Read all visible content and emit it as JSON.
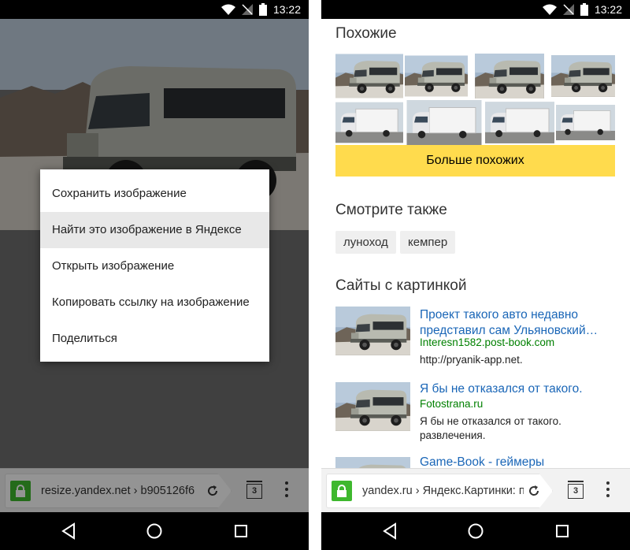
{
  "status": {
    "time": "13:22"
  },
  "left": {
    "context_menu": {
      "items": [
        {
          "label": "Сохранить изображение"
        },
        {
          "label": "Найти это изображение в Яндексе"
        },
        {
          "label": "Открыть изображение"
        },
        {
          "label": "Копировать ссылку на изображение"
        },
        {
          "label": "Поделиться"
        }
      ]
    },
    "omnibox": {
      "url": "resize.yandex.net › b905126f6",
      "tabs_count": "3"
    }
  },
  "right": {
    "similar": {
      "title": "Похожие",
      "more_label": "Больше похожих"
    },
    "see_also": {
      "title": "Смотрите также",
      "chips": [
        "луноход",
        "кемпер"
      ]
    },
    "sites": {
      "title": "Сайты с картинкой",
      "items": [
        {
          "title": "Проект такого авто недавно представил сам Ульяновский…",
          "domain": "Interesn1582.post-book.com",
          "desc": "http://pryanik-app.net."
        },
        {
          "title": "Я бы не отказался от такого.",
          "domain": "Fotostrana.ru",
          "desc": "Я бы не отказался от такого. развлечения."
        },
        {
          "title": "Game-Book - геймеры",
          "domain": "",
          "desc": ""
        }
      ]
    },
    "omnibox": {
      "url": "yandex.ru › Яндекс.Картинки: п",
      "tabs_count": "3"
    }
  },
  "colors": {
    "accent_yellow": "#ffdb4d",
    "lock_green": "#3eb82e",
    "link_blue": "#1a66b7",
    "domain_green": "#008000"
  }
}
